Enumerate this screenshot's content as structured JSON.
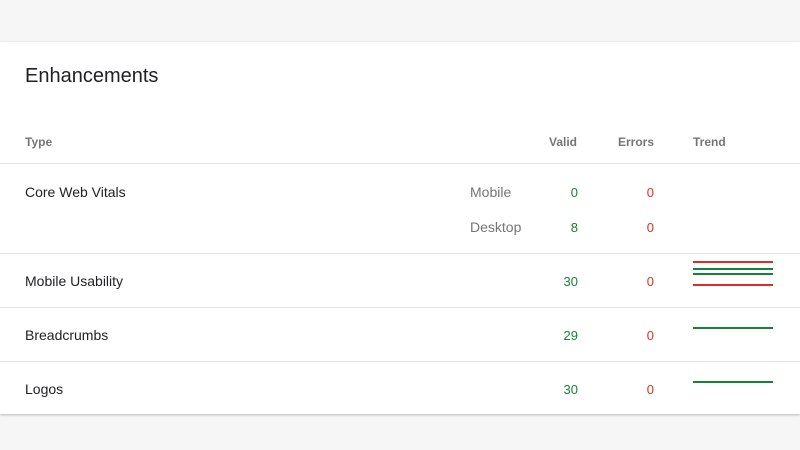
{
  "card": {
    "title": "Enhancements"
  },
  "table": {
    "columns": {
      "type": "Type",
      "valid": "Valid",
      "errors": "Errors",
      "trend": "Trend"
    },
    "rows": [
      {
        "label": "Core Web Vitals",
        "sub": [
          {
            "device": "Mobile",
            "valid": "0",
            "errors": "0",
            "trend": []
          },
          {
            "device": "Desktop",
            "valid": "8",
            "errors": "0",
            "trend": [
              "error",
              "valid"
            ]
          }
        ]
      },
      {
        "label": "Mobile Usability",
        "valid": "30",
        "errors": "0",
        "trend": [
          "valid",
          "error"
        ]
      },
      {
        "label": "Breadcrumbs",
        "valid": "29",
        "errors": "0",
        "trend": [
          "valid"
        ]
      },
      {
        "label": "Logos",
        "valid": "30",
        "errors": "0",
        "trend": [
          "valid"
        ]
      }
    ]
  },
  "colors": {
    "valid": "#188038",
    "error": "#d93025"
  }
}
